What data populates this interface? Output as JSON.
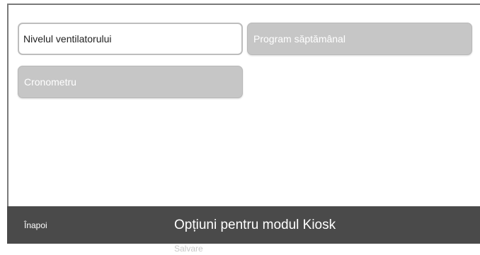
{
  "options": {
    "fan_level": "Nivelul ventilatorului",
    "weekly_program": "Program săptămânal",
    "timer": "Cronometru"
  },
  "footer": {
    "back_label": "Înapoi",
    "title": "Opțiuni pentru modul Kiosk",
    "save_label": "Salvare"
  },
  "colors": {
    "button_bg": "#c6c6c6",
    "bar_bg": "#4a4a4a",
    "border": "#7a7a7a"
  }
}
